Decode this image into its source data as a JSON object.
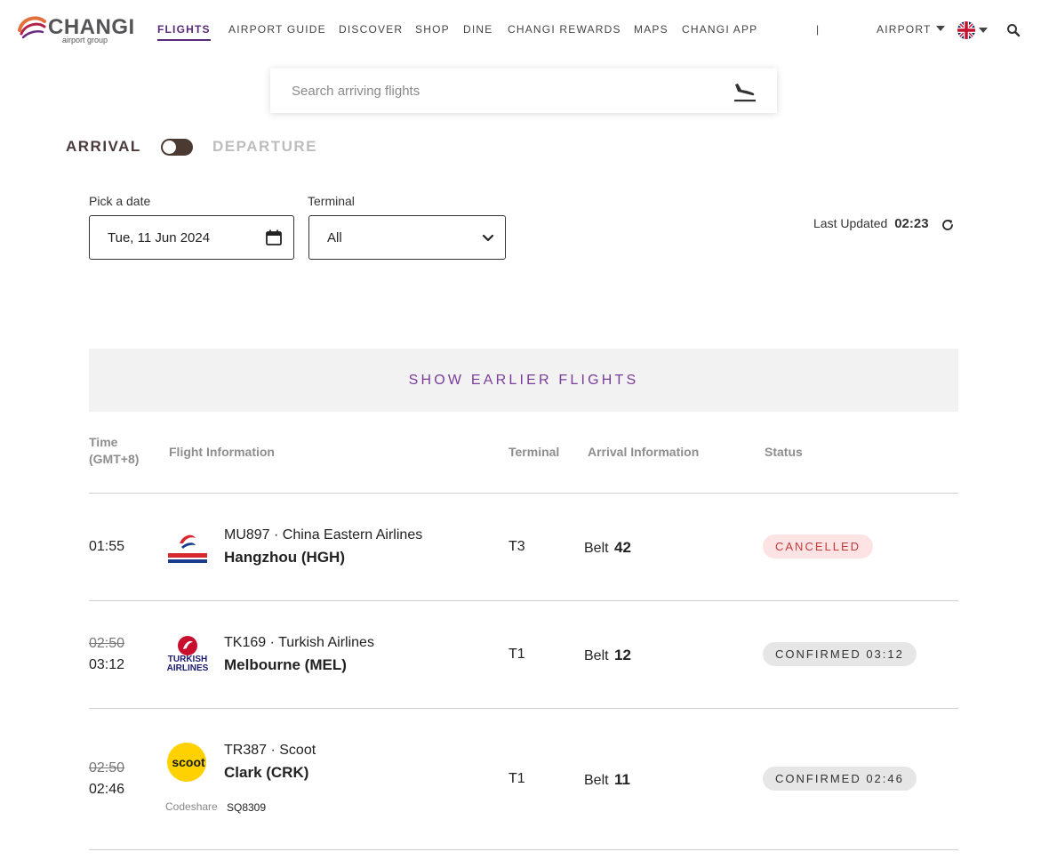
{
  "brand": {
    "name": "CHANGI",
    "sub": "airport group"
  },
  "nav": {
    "items": [
      {
        "label": "FLIGHTS",
        "active": true
      },
      {
        "label": "AIRPORT GUIDE"
      },
      {
        "label": "DISCOVER"
      },
      {
        "label": "SHOP"
      },
      {
        "label": "DINE"
      },
      {
        "label": "CHANGI REWARDS"
      },
      {
        "label": "MAPS"
      },
      {
        "label": "CHANGI APP"
      }
    ],
    "separator": "|",
    "airport_label": "AIRPORT"
  },
  "search": {
    "placeholder": "Search arriving flights"
  },
  "toggle": {
    "arrival": "ARRIVAL",
    "departure": "DEPARTURE"
  },
  "filters": {
    "date_label": "Pick a date",
    "date_value": "Tue, 11 Jun 2024",
    "terminal_label": "Terminal",
    "terminal_value": "All",
    "last_updated_label": "Last Updated",
    "last_updated_time": "02:23"
  },
  "show_earlier": "SHOW EARLIER FLIGHTS",
  "table": {
    "headers": {
      "time_line1": "Time",
      "time_line2": "(GMT+8)",
      "flight": "Flight Information",
      "terminal": "Terminal",
      "arrival": "Arrival Information",
      "status": "Status"
    },
    "rows": [
      {
        "time": "01:55",
        "flight": "MU897 · China Eastern Airlines",
        "destination": "Hangzhou (HGH)",
        "terminal": "T3",
        "belt_label": "Belt",
        "belt": "42",
        "status": "CANCELLED",
        "airline_logo": "china-eastern-logo"
      },
      {
        "scheduled_time": "02:50",
        "time": "03:12",
        "flight": "TK169 · Turkish Airlines",
        "destination": "Melbourne (MEL)",
        "terminal": "T1",
        "belt_label": "Belt",
        "belt": "12",
        "status": "CONFIRMED 03:12",
        "airline_logo": "turkish-airlines-logo"
      },
      {
        "scheduled_time": "02:50",
        "time": "02:46",
        "flight": "TR387 · Scoot",
        "destination": "Clark (CRK)",
        "terminal": "T1",
        "belt_label": "Belt",
        "belt": "11",
        "status": "CONFIRMED 02:46",
        "airline_logo": "scoot-logo",
        "codeshare_label": "Codeshare",
        "codeshare": "SQ8309"
      }
    ]
  },
  "colors": {
    "accent_purple": "#7a3d9a",
    "toggle_dark": "#4a3a32",
    "cancelled_bg": "#fde3e3",
    "cancelled_text": "#c23a3a",
    "confirmed_bg": "#e6e6e6",
    "scoot_yellow": "#ffd100",
    "china_eastern_red": "#d7282f",
    "china_eastern_blue": "#1a3d8f",
    "turkish_red": "#c8102e"
  },
  "icons": [
    "changi-logo-icon",
    "caret-down-icon",
    "uk-flag-icon",
    "search-icon",
    "plane-landing-icon",
    "calendar-icon",
    "chevron-down-icon",
    "refresh-icon"
  ]
}
